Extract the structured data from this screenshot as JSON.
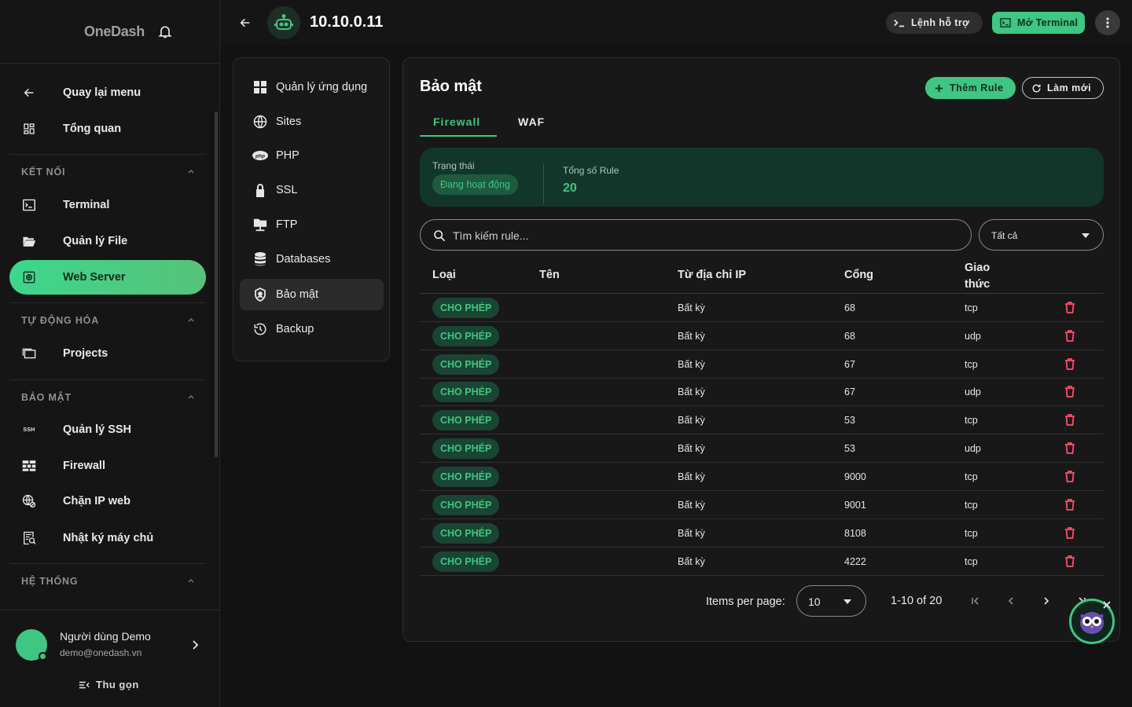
{
  "sidebar": {
    "brand": "OneDash",
    "back_label": "Quay lại menu",
    "overview_label": "Tổng quan",
    "sections": {
      "connect": "KẾT NỐI",
      "automation": "TỰ ĐỘNG HÓA",
      "security": "BẢO MẬT",
      "system": "HỆ THỐNG"
    },
    "items": {
      "terminal": "Terminal",
      "file_manager": "Quản lý File",
      "web_server": "Web Server",
      "projects": "Projects",
      "ssh": "Quản lý SSH",
      "firewall": "Firewall",
      "block_ip": "Chặn IP web",
      "server_log": "Nhật ký máy chủ"
    },
    "ssh_icon_text": "SSH",
    "user": {
      "name": "Người dùng Demo",
      "email": "demo@onedash.vn"
    },
    "collapse_label": "Thu gọn"
  },
  "topbar": {
    "server_title": "10.10.0.11",
    "help_cmd_label": "Lệnh hỗ trợ",
    "open_terminal_label": "Mở Terminal"
  },
  "inner_menu": {
    "items": [
      {
        "label": "Quản lý ứng dụng",
        "icon": "grid-icon"
      },
      {
        "label": "Sites",
        "icon": "globe-icon"
      },
      {
        "label": "PHP",
        "icon": "php-icon"
      },
      {
        "label": "SSL",
        "icon": "lock-icon"
      },
      {
        "label": "FTP",
        "icon": "folder-network-icon"
      },
      {
        "label": "Databases",
        "icon": "database-icon"
      },
      {
        "label": "Bảo mật",
        "icon": "shield-icon"
      },
      {
        "label": "Backup",
        "icon": "history-icon"
      }
    ],
    "active": "Bảo mật"
  },
  "security": {
    "title": "Bảo mật",
    "add_rule_label": "Thêm Rule",
    "refresh_label": "Làm mới",
    "tabs": [
      "Firewall",
      "WAF"
    ],
    "active_tab": "Firewall",
    "status_label": "Trạng thái",
    "status_value": "Đang hoạt động",
    "total_label": "Tổng số Rule",
    "total_value": "20",
    "search_placeholder": "Tìm kiếm rule...",
    "filter_value": "Tất cả",
    "columns": {
      "type": "Loại",
      "name": "Tên",
      "source": "Từ địa chỉ IP",
      "port": "Cổng",
      "protocol": "Giao thức"
    },
    "rows": [
      {
        "type": "CHO PHÉP",
        "name": "",
        "source": "Bất kỳ",
        "port": "68",
        "protocol": "tcp"
      },
      {
        "type": "CHO PHÉP",
        "name": "",
        "source": "Bất kỳ",
        "port": "68",
        "protocol": "udp"
      },
      {
        "type": "CHO PHÉP",
        "name": "",
        "source": "Bất kỳ",
        "port": "67",
        "protocol": "tcp"
      },
      {
        "type": "CHO PHÉP",
        "name": "",
        "source": "Bất kỳ",
        "port": "67",
        "protocol": "udp"
      },
      {
        "type": "CHO PHÉP",
        "name": "",
        "source": "Bất kỳ",
        "port": "53",
        "protocol": "tcp"
      },
      {
        "type": "CHO PHÉP",
        "name": "",
        "source": "Bất kỳ",
        "port": "53",
        "protocol": "udp"
      },
      {
        "type": "CHO PHÉP",
        "name": "",
        "source": "Bất kỳ",
        "port": "9000",
        "protocol": "tcp"
      },
      {
        "type": "CHO PHÉP",
        "name": "",
        "source": "Bất kỳ",
        "port": "9001",
        "protocol": "tcp"
      },
      {
        "type": "CHO PHÉP",
        "name": "",
        "source": "Bất kỳ",
        "port": "8108",
        "protocol": "tcp"
      },
      {
        "type": "CHO PHÉP",
        "name": "",
        "source": "Bất kỳ",
        "port": "4222",
        "protocol": "tcp"
      }
    ],
    "pagination": {
      "items_per_page_label": "Items per page:",
      "items_per_page": "10",
      "range": "1-10 of 20"
    }
  },
  "colors": {
    "accent": "#3ec682",
    "danger": "#ff4d6a",
    "background": "#121212",
    "surface": "#181818"
  }
}
